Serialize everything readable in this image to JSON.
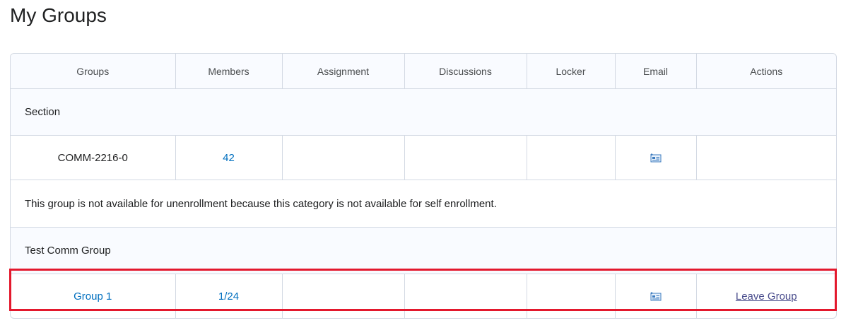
{
  "page": {
    "title": "My Groups"
  },
  "table": {
    "headers": [
      "Groups",
      "Members",
      "Assignment",
      "Discussions",
      "Locker",
      "Email",
      "Actions"
    ],
    "section_1": {
      "label": "Section",
      "row": {
        "group": "COMM-2216-0",
        "members": "42",
        "email_icon": "email-icon"
      },
      "note": "This group is not available for unenrollment because this category is not available for self enrollment."
    },
    "section_2": {
      "label": "Test Comm Group",
      "row": {
        "group": "Group 1",
        "members": "1/24",
        "email_icon": "email-icon",
        "action": "Leave Group"
      }
    }
  },
  "colors": {
    "link": "#006fbf",
    "highlight": "#e3182d",
    "border": "#d3d9e3",
    "header_bg": "#f9fbff"
  }
}
